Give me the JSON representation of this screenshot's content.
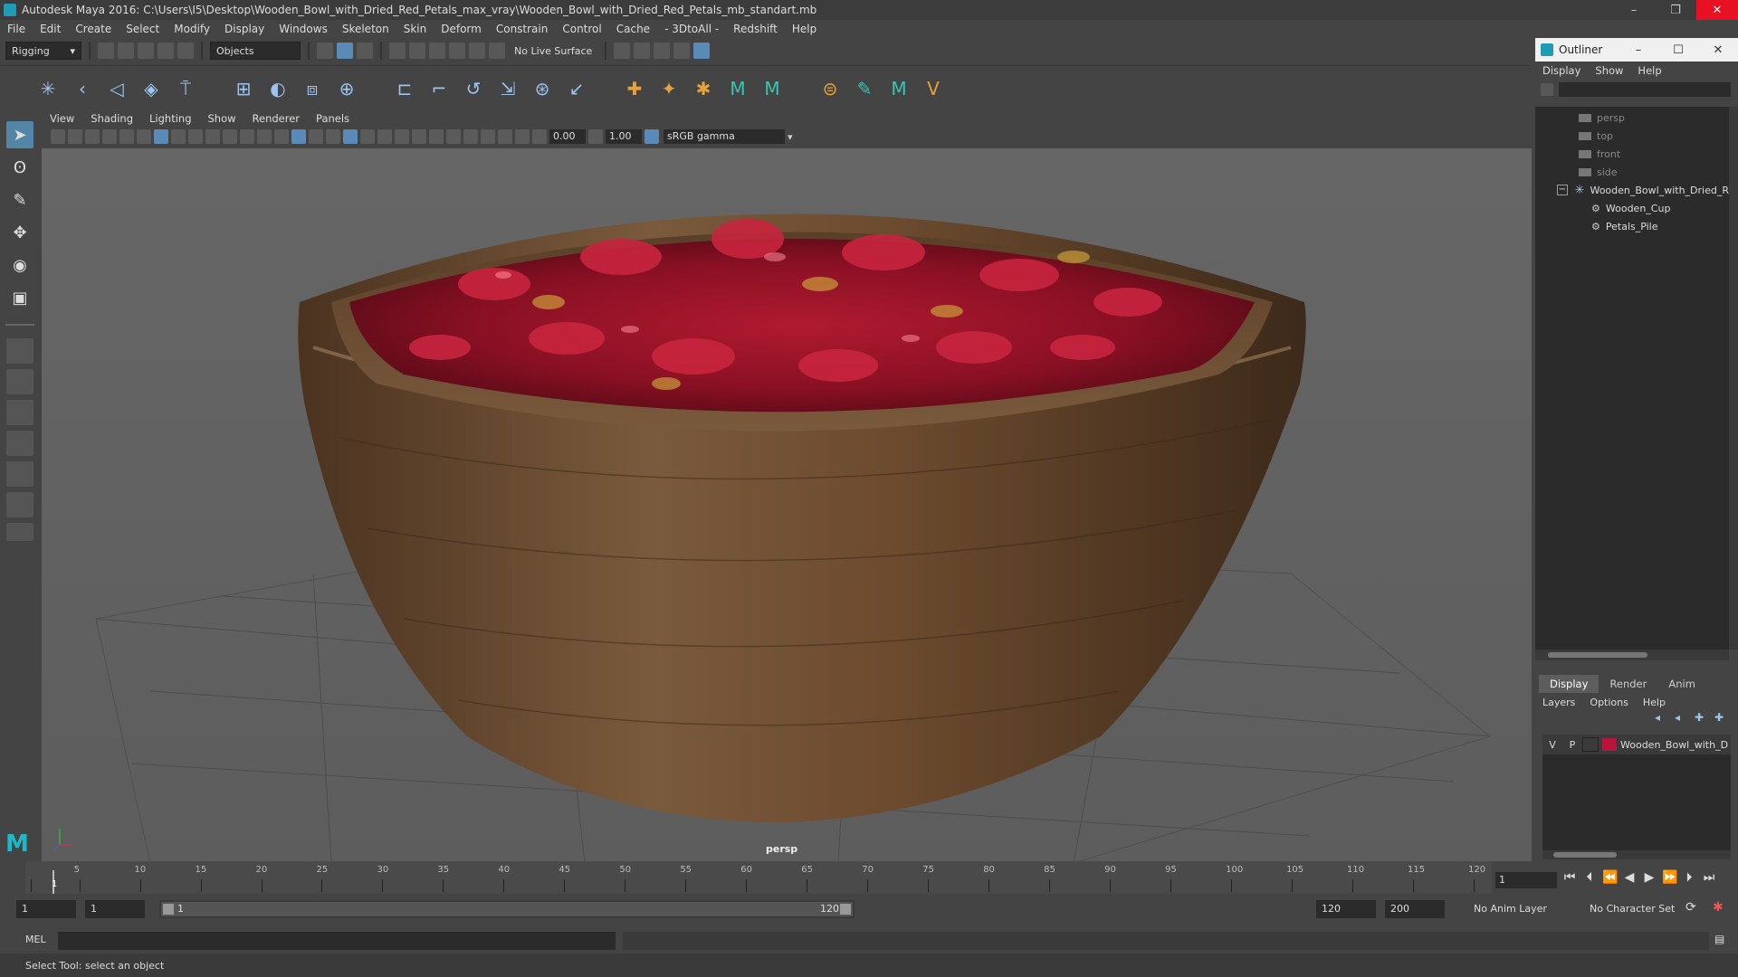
{
  "window": {
    "title": "Autodesk Maya 2016: C:\\Users\\I5\\Desktop\\Wooden_Bowl_with_Dried_Red_Petals_max_vray\\Wooden_Bowl_with_Dried_Red_Petals_mb_standart.mb",
    "minimize": "–",
    "restore": "❐",
    "close": "✕"
  },
  "menubar": [
    "File",
    "Edit",
    "Create",
    "Select",
    "Modify",
    "Display",
    "Windows",
    "Skeleton",
    "Skin",
    "Deform",
    "Constrain",
    "Control",
    "Cache",
    "- 3DtoAll -",
    "Redshift",
    "Help"
  ],
  "statusline": {
    "menuset": "Rigging",
    "selection_mode": "Objects",
    "live_surface": "No Live Surface"
  },
  "panel": {
    "menus": [
      "View",
      "Shading",
      "Lighting",
      "Show",
      "Renderer",
      "Panels"
    ],
    "exposure": "0.00",
    "gamma_value": "1.00",
    "color_space": "sRGB gamma",
    "camera_label": "persp"
  },
  "outliner": {
    "title": "Outliner",
    "menus": [
      "Display",
      "Show",
      "Help"
    ],
    "cameras": [
      "persp",
      "top",
      "front",
      "side"
    ],
    "group": "Wooden_Bowl_with_Dried_R",
    "children": [
      "Wooden_Cup",
      "Petals_Pile"
    ]
  },
  "layer_editor": {
    "tabs": [
      "Display",
      "Render",
      "Anim"
    ],
    "menus": [
      "Layers",
      "Options",
      "Help"
    ],
    "layer": {
      "v": "V",
      "p": "P",
      "name": "Wooden_Bowl_with_D",
      "color": "#b8143c"
    }
  },
  "timeline": {
    "ticks": [
      1,
      5,
      10,
      15,
      20,
      25,
      30,
      35,
      40,
      45,
      50,
      55,
      60,
      65,
      70,
      75,
      80,
      85,
      90,
      95,
      100,
      105,
      110,
      115,
      120
    ],
    "start": 1,
    "end": 120,
    "current_frame": "1",
    "current_frame_label": "1"
  },
  "range": {
    "start_field": "1",
    "playback_start": "1",
    "range_start_label": "1",
    "range_end_label": "120",
    "playback_end": "120",
    "end_field": "200",
    "anim_layer": "No Anim Layer",
    "character_set": "No Character Set"
  },
  "command": {
    "label": "MEL"
  },
  "help_line": "Select Tool: select an object"
}
